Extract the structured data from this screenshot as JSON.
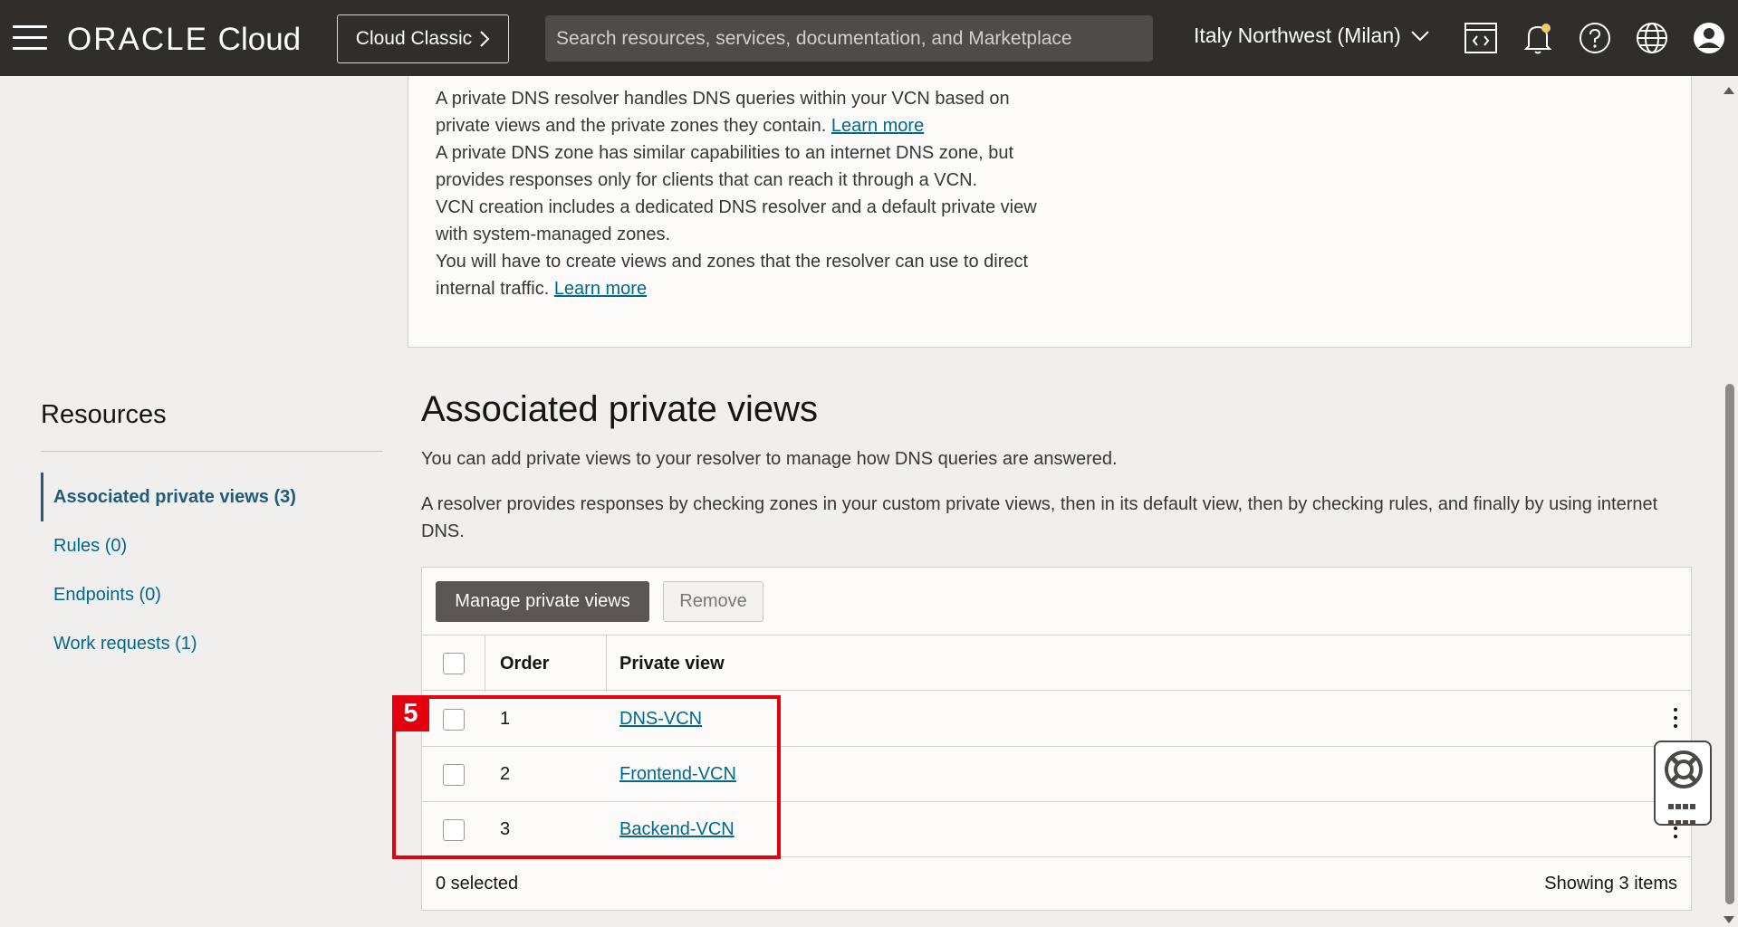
{
  "header": {
    "logo_brand": "ORACLE",
    "logo_product": "Cloud",
    "classic_button": "Cloud Classic",
    "search_placeholder": "Search resources, services, documentation, and Marketplace",
    "region": "Italy Northwest (Milan)",
    "icons": [
      "hamburger-icon",
      "code-editor-icon",
      "notification-bell-icon",
      "help-icon",
      "globe-icon",
      "user-avatar-icon"
    ],
    "accent_color": "#312d2a"
  },
  "info": {
    "lines1": "A private DNS resolver handles DNS queries within your VCN based on private views and the private zones they contain.",
    "link1": "Learn more",
    "lines2": "A private DNS zone has similar capabilities to an internet DNS zone, but provides responses only for clients that can reach it through a VCN.",
    "lines3": "VCN creation includes a dedicated DNS resolver and a default private view with system-managed zones.",
    "lines4": "You will have to create views and zones that the resolver can use to direct internal traffic.",
    "link2": "Learn more"
  },
  "resources": {
    "title": "Resources",
    "items": [
      {
        "label": "Associated private views (3)",
        "active": true
      },
      {
        "label": "Rules (0)",
        "active": false
      },
      {
        "label": "Endpoints (0)",
        "active": false
      },
      {
        "label": "Work requests (1)",
        "active": false
      }
    ]
  },
  "section": {
    "title": "Associated private views",
    "desc1": "You can add private views to your resolver to manage how DNS queries are answered.",
    "desc2": "A resolver provides responses by checking zones in your custom private views, then in its default view, then by checking rules, and finally by using internet DNS."
  },
  "table": {
    "manage_button": "Manage private views",
    "remove_button": "Remove",
    "columns": [
      "Order",
      "Private view"
    ],
    "rows": [
      {
        "order": "1",
        "view": "DNS-VCN"
      },
      {
        "order": "2",
        "view": "Frontend-VCN"
      },
      {
        "order": "3",
        "view": "Backend-VCN"
      }
    ],
    "selected": "0 selected",
    "showing": "Showing 3 items"
  },
  "annotation": {
    "badge": "5",
    "color": "#e3000f"
  }
}
